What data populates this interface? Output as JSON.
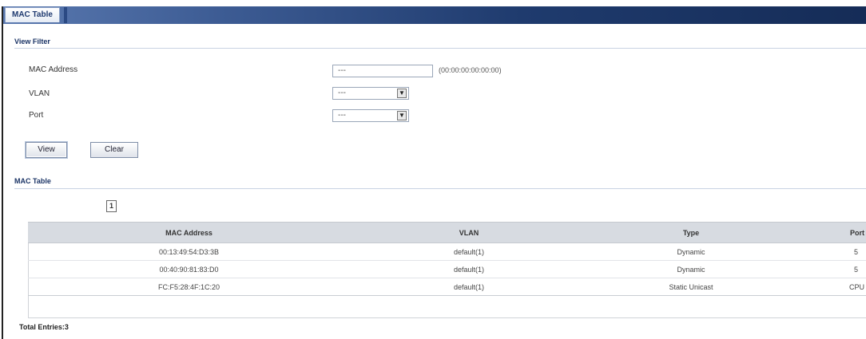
{
  "window": {
    "tab_title": "MAC Table"
  },
  "view_filter": {
    "title": "View Filter",
    "mac_address_label": "MAC Address",
    "mac_address_value": "---",
    "mac_address_hint": "(00:00:00:00:00:00)",
    "vlan_label": "VLAN",
    "vlan_value": "---",
    "port_label": "Port",
    "port_value": "---",
    "view_button": "View",
    "clear_button": "Clear"
  },
  "mac_table": {
    "title": "MAC Table",
    "page_indicator": "1",
    "columns": [
      "MAC Address",
      "VLAN",
      "Type",
      "Port"
    ],
    "rows": [
      {
        "mac": "00:13:49:54:D3:3B",
        "vlan": "default(1)",
        "type": "Dynamic",
        "port": "5"
      },
      {
        "mac": "00:40:90:81:83:D0",
        "vlan": "default(1)",
        "type": "Dynamic",
        "port": "5"
      },
      {
        "mac": "FC:F5:28:4F:1C:20",
        "vlan": "default(1)",
        "type": "Static Unicast",
        "port": "CPU"
      }
    ],
    "total_entries": "Total Entries:3"
  },
  "colors": {
    "title_bar": "#1f3b6e",
    "header_row": "#d7dbe1",
    "section_text": "#1b3466"
  }
}
